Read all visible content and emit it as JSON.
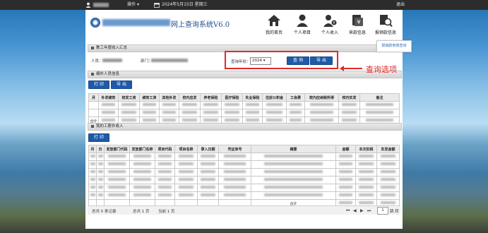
{
  "topbar": {
    "ops_label": "操作",
    "date": "2024年5月15日 星期三",
    "exit_label": "退出"
  },
  "header": {
    "system_name": "网上查询系统V6.0",
    "nav": [
      {
        "label": "我的首页",
        "icon": "home-icon"
      },
      {
        "label": "个人项目",
        "icon": "person-icon"
      },
      {
        "label": "个人收入",
        "icon": "person-income-icon"
      },
      {
        "label": "来款信息",
        "icon": "money-icon"
      },
      {
        "label": "报销款信息",
        "icon": "search-doc-icon"
      }
    ],
    "dropdown_item": "报销款到账查询"
  },
  "summary": {
    "title": "教工年度收入汇总",
    "person_label": "人员：",
    "dept_label": "部门：",
    "year_label": "查询年份：",
    "year_value": "2024",
    "query_button": "查 询",
    "export_button": "导 出"
  },
  "annotation": {
    "text": "查询选项"
  },
  "payroll": {
    "title": "编外人员信息",
    "print_button": "打 印",
    "export_button": "导 出",
    "columns": [
      "月",
      "补发绩效",
      "校发工资",
      "绩效工资",
      "其他补发",
      "校内应发",
      "养老保险",
      "医疗保险",
      "失业保险",
      "住房公积金",
      "工会费",
      "校内应纳税所得",
      "校内实发",
      "备注"
    ],
    "total_label": "合计"
  },
  "extra_income": {
    "title": "我的工薪外收入",
    "print_button": "打 印",
    "columns": [
      "月",
      "日",
      "发放部门代码",
      "发放部门名称",
      "项目代码",
      "项目名称",
      "录入日期",
      "凭证单号",
      "摘要",
      "金额",
      "本次扣税",
      "实发金额"
    ],
    "total_label": "合计"
  },
  "footer": {
    "total_records": "总共 5 条记录",
    "total_pages": "总共 1 页",
    "current_page": "当前 1 页",
    "page_input": "1",
    "jump_label": "跳 转"
  }
}
